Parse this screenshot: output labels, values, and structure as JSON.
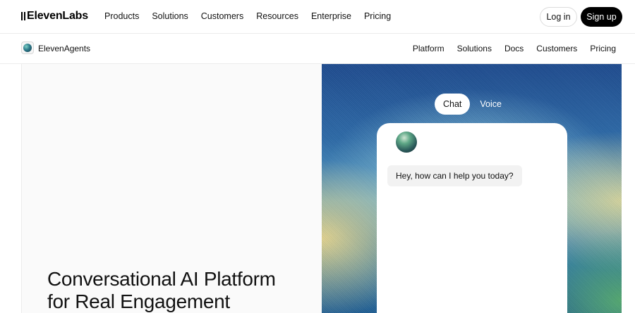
{
  "brand": {
    "name": "ElevenLabs"
  },
  "top_nav": {
    "items": [
      "Products",
      "Solutions",
      "Customers",
      "Resources",
      "Enterprise",
      "Pricing"
    ],
    "login_label": "Log in",
    "signup_label": "Sign up"
  },
  "sub_nav": {
    "product_name": "ElevenAgents",
    "items": [
      "Platform",
      "Solutions",
      "Docs",
      "Customers",
      "Pricing"
    ]
  },
  "hero": {
    "title_line1": "Conversational AI Platform",
    "title_line2": "for Real Engagement"
  },
  "demo": {
    "tabs": [
      "Chat",
      "Voice"
    ],
    "active_tab": "Chat",
    "greeting": "Hey, how can I help you today?"
  },
  "colors": {
    "accent": "#000000",
    "page_bg": "#ffffff",
    "hero_bg": "#fafafa"
  }
}
